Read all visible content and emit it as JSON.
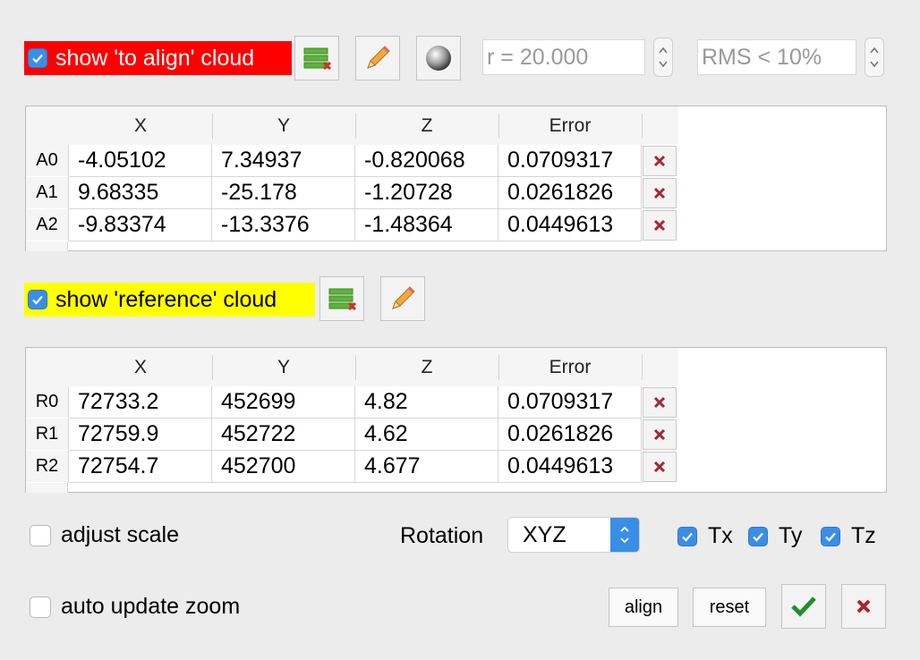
{
  "align_cloud": {
    "checkbox_label": "show 'to align' cloud",
    "checked": true,
    "highlight_color": "#ff0000",
    "radius_field": "r = 20.000",
    "rms_field": "RMS < 10%",
    "table": {
      "columns": [
        "X",
        "Y",
        "Z",
        "Error"
      ],
      "rows": [
        {
          "label": "A0",
          "x": "-4.05102",
          "y": "7.34937",
          "z": "-0.820068",
          "error": "0.0709317"
        },
        {
          "label": "A1",
          "x": "9.68335",
          "y": "-25.178",
          "z": "-1.20728",
          "error": "0.0261826"
        },
        {
          "label": "A2",
          "x": "-9.83374",
          "y": "-13.3376",
          "z": "-1.48364",
          "error": "0.0449613"
        }
      ]
    }
  },
  "reference_cloud": {
    "checkbox_label": "show 'reference' cloud",
    "checked": true,
    "highlight_color": "#ffff00",
    "table": {
      "columns": [
        "X",
        "Y",
        "Z",
        "Error"
      ],
      "rows": [
        {
          "label": "R0",
          "x": "72733.2",
          "y": "452699",
          "z": "4.82",
          "error": "0.0709317"
        },
        {
          "label": "R1",
          "x": "72759.9",
          "y": "452722",
          "z": "4.62",
          "error": "0.0261826"
        },
        {
          "label": "R2",
          "x": "72754.7",
          "y": "452700",
          "z": "4.677",
          "error": "0.0449613"
        }
      ]
    }
  },
  "options": {
    "adjust_scale_label": "adjust scale",
    "adjust_scale_checked": false,
    "rotation_label": "Rotation",
    "rotation_value": "XYZ",
    "tx_label": "Tx",
    "ty_label": "Ty",
    "tz_label": "Tz",
    "auto_zoom_label": "auto update zoom",
    "auto_zoom_checked": false
  },
  "buttons": {
    "align": "align",
    "reset": "reset"
  },
  "icons": {
    "layers": "layers-delete-icon",
    "pencil": "pencil-icon",
    "sphere": "sphere-icon",
    "delete": "red-x-icon",
    "ok": "green-check-icon"
  }
}
